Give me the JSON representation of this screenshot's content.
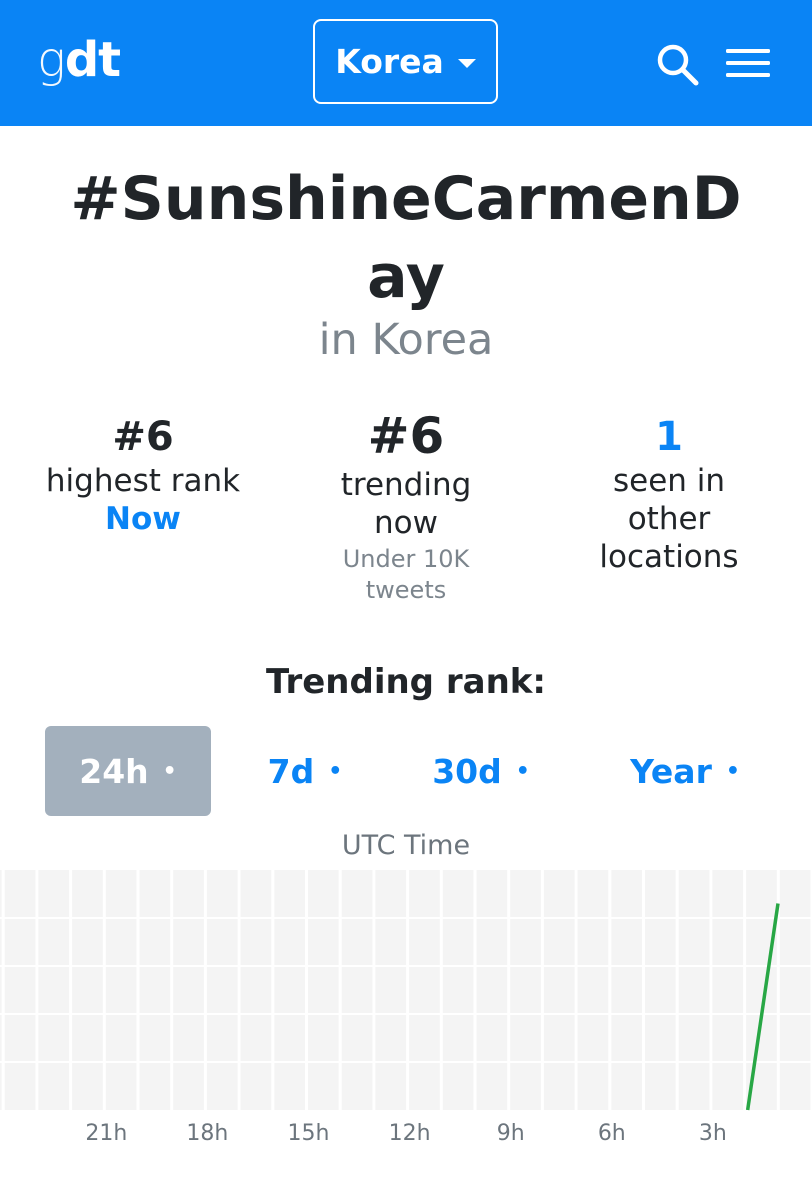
{
  "navbar": {
    "logo_g": "g",
    "logo_dt": "dt",
    "region": "Korea",
    "icons": [
      "search-icon",
      "menu-icon"
    ],
    "accent_color": "#0a84f5"
  },
  "hashtag": {
    "title": "#SunshineCarmenDay",
    "location": "in Korea"
  },
  "stats": {
    "highest": {
      "value": "#6",
      "label": "highest rank",
      "when": "Now"
    },
    "current": {
      "value": "#6",
      "label_line1": "trending",
      "label_line2": "now",
      "volume_line1": "Under 10K",
      "volume_line2": "tweets"
    },
    "locations": {
      "value": "1",
      "label_line1": "seen in",
      "label_line2": "other",
      "label_line3": "locations"
    }
  },
  "trending_section": {
    "title": "Trending rank:",
    "ranges": [
      {
        "label": "24h",
        "active": true
      },
      {
        "label": "7d",
        "active": false
      },
      {
        "label": "30d",
        "active": false
      },
      {
        "label": "Year",
        "active": false
      }
    ],
    "dot": "•"
  },
  "chart_data": {
    "type": "line",
    "title": "",
    "xlabel": "UTC Time",
    "ylabel": "",
    "x_ticks": [
      "21h",
      "18h",
      "15h",
      "12h",
      "9h",
      "6h",
      "3h"
    ],
    "grid": true,
    "line_color": "#28a745",
    "series": [
      {
        "points": [
          {
            "hours_ago": 0.9,
            "rank": 50
          },
          {
            "hours_ago": 0,
            "rank": 6
          }
        ]
      }
    ]
  }
}
